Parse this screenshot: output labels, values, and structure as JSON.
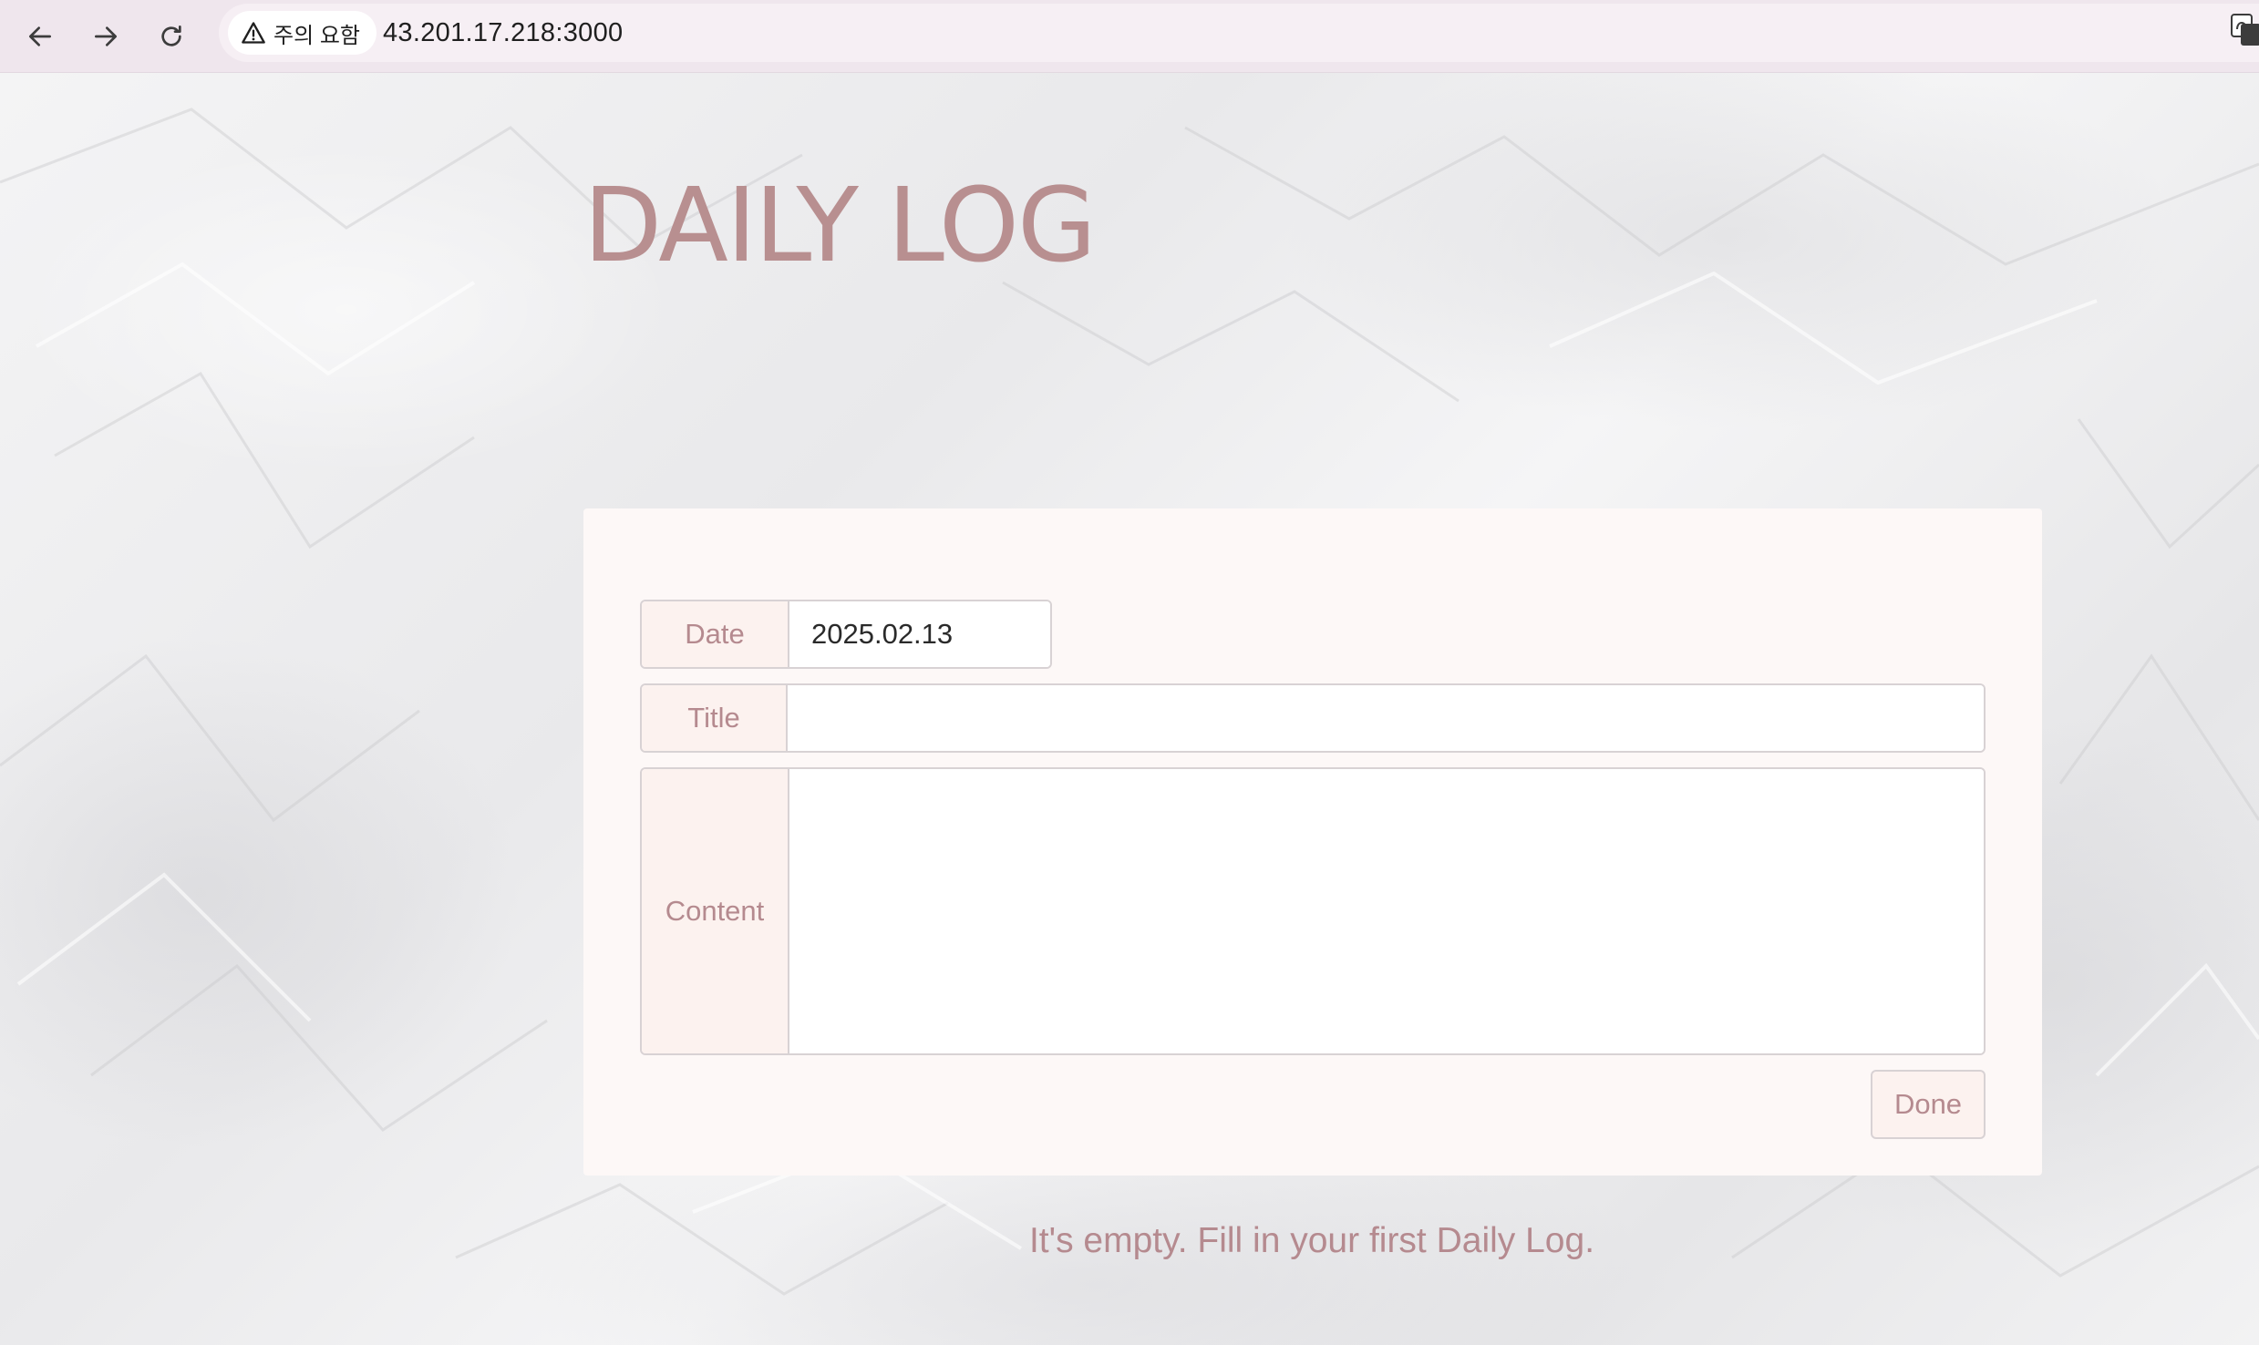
{
  "browser": {
    "security_label": "주의 요함",
    "url": "43.201.17.218:3000"
  },
  "app": {
    "title": "DAILY LOG"
  },
  "form": {
    "date_label": "Date",
    "date_value": "2025.02.13",
    "title_label": "Title",
    "title_value": "",
    "content_label": "Content",
    "content_value": "",
    "done_label": "Done"
  },
  "empty_state": {
    "message": "It's empty. Fill in your first Daily Log."
  },
  "colors": {
    "accent": "#b58a8f",
    "label_bg": "#fcf2ef",
    "card_bg": "#fdf8f7",
    "browser_bar": "#efe6ed"
  },
  "icons": {
    "back": "arrow-left-icon",
    "forward": "arrow-right-icon",
    "reload": "reload-icon",
    "security": "warning-triangle-icon",
    "translate": "translate-icon"
  }
}
